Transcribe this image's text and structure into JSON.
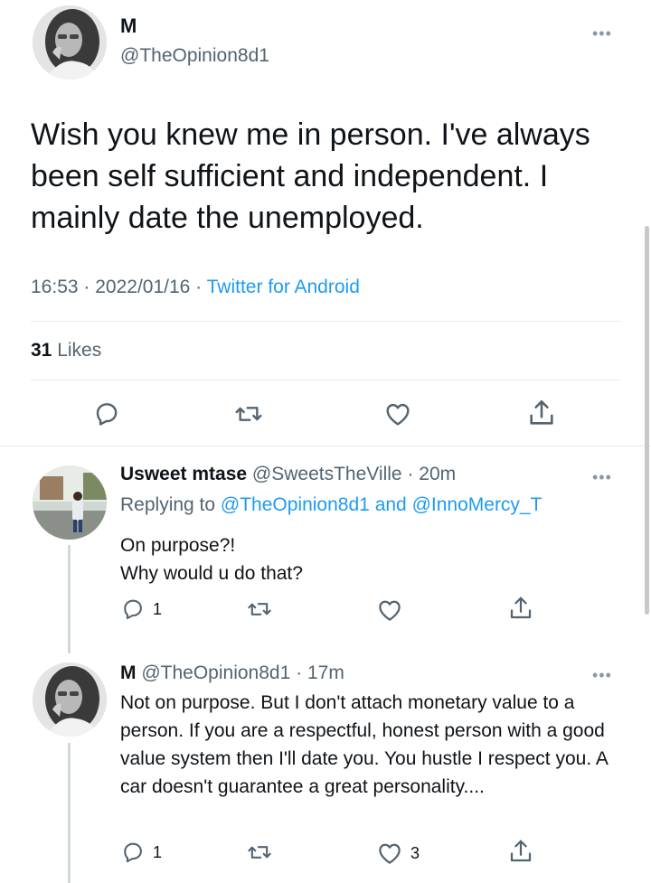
{
  "main_tweet": {
    "display_name": "M",
    "handle": "@TheOpinion8d1",
    "text": "Wish you knew me in person.  I've always been self sufficient and independent. I mainly date the unemployed.",
    "time": "16:53",
    "sep1": " · ",
    "date": "2022/01/16",
    "sep2": " · ",
    "source": "Twitter for Android",
    "likes_count": "31",
    "likes_label": "Likes",
    "more_icon": "more-dots-icon"
  },
  "reply1": {
    "display_name": "Usweet mtase",
    "handle": "@SweetsTheVille",
    "time": "20m",
    "replying_prefix": "Replying to",
    "mention1": "@TheOpinion8d1",
    "and_word": "and",
    "mention2": "@InnoMercy_T",
    "line1": "On purpose?!",
    "line2": "Why would u do that?",
    "reply_count": "1",
    "retweet_count": "",
    "like_count": ""
  },
  "reply2": {
    "display_name": "M",
    "handle": "@TheOpinion8d1",
    "time": "17m",
    "text": "Not on purpose. But I don't attach monetary value to a person. If you are a respectful, honest person with a good value system then I'll date you. You hustle I respect you. A car doesn't guarantee a great personality....",
    "reply_count": "1",
    "retweet_count": "",
    "like_count": "3"
  },
  "colors": {
    "link": "#1d9bf0",
    "secondary_text": "#536471",
    "primary_text": "#0f1419",
    "divider": "#e6ecf0"
  },
  "icons": [
    "reply-icon",
    "retweet-icon",
    "like-icon",
    "share-icon",
    "more-dots-icon"
  ]
}
